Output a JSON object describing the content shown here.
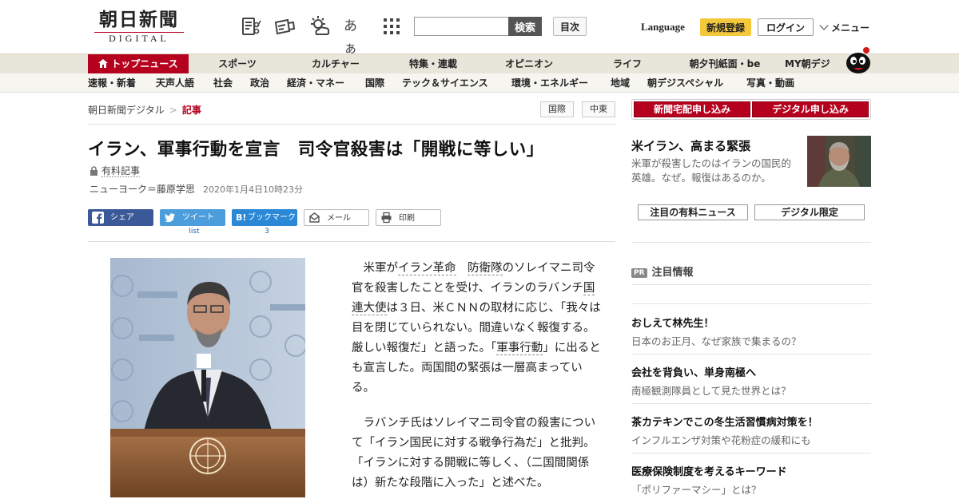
{
  "header": {
    "logo_main": "朝日新聞",
    "logo_sub": "DIGITAL",
    "icons": [
      "newspaper-scrap-icon",
      "delivery-truck-icon",
      "weather-icon",
      "font-size-icon",
      "apps-grid-icon"
    ],
    "font_icon_text": "あぁ",
    "search_placeholder": "",
    "search_label": "検索",
    "toc_label": "目次",
    "language_label": "Language",
    "register_label": "新規登録",
    "login_label": "ログイン",
    "menu_label": "メニュー"
  },
  "nav_primary": [
    {
      "label": "トップニュース"
    },
    {
      "label": "スポーツ"
    },
    {
      "label": "カルチャー"
    },
    {
      "label": "特集・連載"
    },
    {
      "label": "オピニオン"
    },
    {
      "label": "ライフ"
    },
    {
      "label": "朝夕刊紙面・be"
    },
    {
      "label": "MY朝デジ"
    }
  ],
  "nav_secondary": [
    {
      "label": "速報・新着"
    },
    {
      "label": "天声人語"
    },
    {
      "label": "社会"
    },
    {
      "label": "政治"
    },
    {
      "label": "経済・マネー"
    },
    {
      "label": "国際"
    },
    {
      "label": "テック＆サイエンス"
    },
    {
      "label": "環境・エネルギー"
    },
    {
      "label": "地域"
    },
    {
      "label": "朝デジスペシャル"
    },
    {
      "label": "写真・動画"
    }
  ],
  "breadcrumb": {
    "root": "朝日新聞デジタル",
    "separator": ">",
    "current": "記事"
  },
  "tags": [
    "国際",
    "中東"
  ],
  "article": {
    "title": "イラン、軍事行動を宣言　司令官殺害は「開戦に等しい」",
    "paid_label": "有料記事",
    "byline": "ニューヨーク＝藤原学思",
    "date": "2020年1月4日10時23分",
    "p1": {
      "a": "米軍が",
      "kw1": "イラン革命",
      "b": "　",
      "kw2": "防衛隊",
      "c": "のソレイマニ司令官を殺害したことを受け、イランのラバンチ",
      "kw3": "国連大使",
      "d": "は３日、米ＣＮＮの取材に応じ、「我々は目を閉じていられない。間違いなく報復する。厳しい報復だ」と語った。「",
      "kw4": "軍事行動",
      "e": "」に出るとも宣言した。両国間の緊張は一層高まっている。"
    },
    "p2": "ラバンチ氏はソレイマニ司令官の殺害について「イラン国民に対する戦争行為だ」と批判。「イランに対する開戦に等しく、（二国間関係は）新たな段階に入った」と述べた。"
  },
  "share": {
    "facebook": "シェア",
    "twitter": "ツイート",
    "hatena": "ブックマーク",
    "mail": "メール",
    "print": "印刷",
    "twitter_count": "list",
    "hatena_count": "3"
  },
  "sidebar": {
    "subscribe_paper": "新聞宅配申し込み",
    "subscribe_digital": "デジタル申し込み",
    "feature_title": "米イラン、高まる緊張",
    "feature_desc": "米軍が殺害したのはイランの国民的英雄。なぜ。報復はあるのか。",
    "tab_paid": "注目の有料ニュース",
    "tab_digital": "デジタル限定",
    "pr_badge": "PR",
    "pr_heading": "注目情報",
    "pr_items": [
      {
        "title": "おしえて林先生！",
        "desc": "日本のお正月、なぜ家族で集まるの？"
      },
      {
        "title": "会社を背負い、単身南極へ",
        "desc": "南極観測隊員として見た世界とは？"
      },
      {
        "title": "茶カテキンでこの冬生活習慣病対策を！",
        "desc": "インフルエンザ対策や花粉症の緩和にも"
      },
      {
        "title": "医療保険制度を考えるキーワード",
        "desc": "「ポリファーマシー」とは？"
      }
    ]
  },
  "colors": {
    "brand_red": "#b5001e",
    "register_yellow": "#f3c83a",
    "facebook": "#3b5998",
    "twitter": "#4b9edb",
    "hatena": "#2a88d6"
  }
}
